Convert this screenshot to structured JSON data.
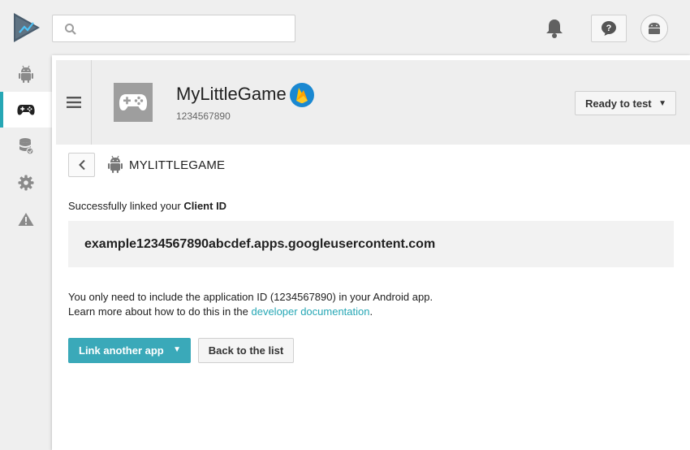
{
  "topbar": {
    "logo_icon": "play-console-logo-icon",
    "search": {
      "placeholder": "",
      "value": "",
      "icon": "search-icon"
    },
    "notifications_icon": "bell-icon",
    "help_icon": "help-icon",
    "account_icon": "android-avatar-icon"
  },
  "sidebar": {
    "items": [
      {
        "icon": "android-icon",
        "active": false
      },
      {
        "icon": "gamepad-icon",
        "active": true
      },
      {
        "icon": "database-icon",
        "active": false
      },
      {
        "icon": "gear-icon",
        "active": false
      },
      {
        "icon": "warning-icon",
        "active": false
      }
    ],
    "active_color": "#26a7b5"
  },
  "app": {
    "name": "MyLittleGame",
    "id": "1234567890",
    "icon": "gamepad-icon",
    "badge_icon": "firebase-icon",
    "status": "Ready to test"
  },
  "section": {
    "title": "MYLITTLEGAME",
    "platform_icon": "android-icon"
  },
  "message": {
    "prefix": "Successfully linked your ",
    "bold": "Client ID"
  },
  "client_id": "example1234567890abcdef.apps.googleusercontent.com",
  "info": {
    "line1": "You only need to include the application ID (1234567890) in your Android app.",
    "line2_prefix": "Learn more about how to do this in the ",
    "link": "developer documentation",
    "line2_suffix": "."
  },
  "actions": {
    "primary": "Link another app",
    "secondary": "Back to the list"
  },
  "colors": {
    "accent": "#26a7b5",
    "primary_button": "#3aa9b9",
    "firebase_badge": "#1a88d1"
  }
}
